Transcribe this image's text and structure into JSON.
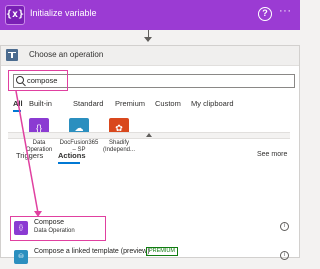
{
  "top_action": {
    "icon": "{x}",
    "title": "Initialize variable",
    "help_icon": "?",
    "more_icon": "···"
  },
  "panel": {
    "title": "Choose an operation"
  },
  "search": {
    "value": "compose"
  },
  "tabs": [
    "All",
    "Built-in",
    "Standard",
    "Premium",
    "Custom",
    "My clipboard"
  ],
  "connectors": [
    {
      "label": "Data Operation",
      "color": "#8b3bd2",
      "icon": "{}"
    },
    {
      "label": "DocFusion365 – SP",
      "color": "#2b8fbf",
      "icon": "☁"
    },
    {
      "label": "Shadify (Independ...",
      "color": "#d9481d",
      "icon": "✿"
    }
  ],
  "tabs2": {
    "triggers": "Triggers",
    "actions": "Actions",
    "see_more": "See more"
  },
  "results": [
    {
      "title": "Compose",
      "subtitle": "Data Operation",
      "color": "#8b3bd2",
      "icon": "{}"
    },
    {
      "title": "Compose a linked template (preview)",
      "badge": "PREMIUM",
      "color": "#2b8fbf",
      "icon": "⛁"
    }
  ],
  "colors": {
    "highlight": "#e040a0",
    "action_purple": "#9b3bd3",
    "accent": "#0078d4"
  }
}
